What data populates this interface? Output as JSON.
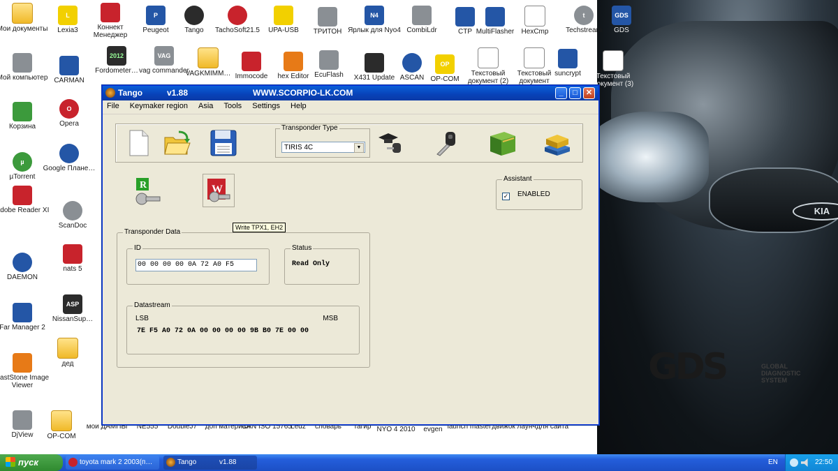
{
  "desktop": {
    "icons": [
      {
        "label": "Мои документы",
        "icon": "my-documents-icon"
      },
      {
        "label": "Lexia3",
        "icon": "lexia3-icon"
      },
      {
        "label": "Коннект Менеджер",
        "icon": "connect-manager-icon"
      },
      {
        "label": "Peugeot",
        "icon": "peugeot-icon"
      },
      {
        "label": "Tango",
        "icon": "tango-icon"
      },
      {
        "label": "TachoSoft21.5",
        "icon": "tachosoft-icon"
      },
      {
        "label": "UPA-USB",
        "icon": "upa-usb-icon"
      },
      {
        "label": "ТРИТОН",
        "icon": "triton-icon"
      },
      {
        "label": "Ярлык для Nyo4",
        "icon": "nyo4-icon"
      },
      {
        "label": "CombiLdr",
        "icon": "combildr-icon"
      },
      {
        "label": "CTP",
        "icon": "ctp-icon"
      },
      {
        "label": "MultiFlasher",
        "icon": "multiflasher-icon"
      },
      {
        "label": "HexCmp",
        "icon": "hexcmp-icon"
      },
      {
        "label": "Techstream",
        "icon": "techstream-icon"
      },
      {
        "label": "GDS",
        "icon": "gds-icon"
      },
      {
        "label": "Мой компьютер",
        "icon": "my-computer-icon"
      },
      {
        "label": "CARMAN",
        "icon": "carman-icon"
      },
      {
        "label": "Fordometer…",
        "icon": "fordometer-icon"
      },
      {
        "label": "vag commander",
        "icon": "vag-commander-icon"
      },
      {
        "label": "VAGKMIMM…",
        "icon": "folder-icon"
      },
      {
        "label": "Immocode",
        "icon": "immocode-icon"
      },
      {
        "label": "hex Editor",
        "icon": "hex-editor-icon"
      },
      {
        "label": "EcuFlash",
        "icon": "ecuflash-icon"
      },
      {
        "label": "X431 Update",
        "icon": "x431-icon"
      },
      {
        "label": "ASCAN",
        "icon": "ascan-icon"
      },
      {
        "label": "OP-COM",
        "icon": "opcom-icon"
      },
      {
        "label": "Текстовый документ (2)",
        "icon": "text-document-icon"
      },
      {
        "label": "Текстовый документ",
        "icon": "text-document-icon"
      },
      {
        "label": "suncrypt",
        "icon": "suncrypt-icon"
      },
      {
        "label": "Текстовый документ (3)",
        "icon": "text-document-icon"
      },
      {
        "label": "Корзина",
        "icon": "recycle-bin-icon"
      },
      {
        "label": "Opera",
        "icon": "opera-icon"
      },
      {
        "label": "µTorrent",
        "icon": "utorrent-icon"
      },
      {
        "label": "Google Плане…",
        "icon": "google-earth-icon"
      },
      {
        "label": "Adobe Reader XI",
        "icon": "adobe-reader-icon"
      },
      {
        "label": "ScanDoc",
        "icon": "scandoc-icon"
      },
      {
        "label": "nats 5",
        "icon": "nats-icon"
      },
      {
        "label": "DAEMON",
        "icon": "daemon-icon"
      },
      {
        "label": "Far Manager 2",
        "icon": "far-manager-icon"
      },
      {
        "label": "NissanSup…",
        "icon": "nissan-icon"
      },
      {
        "label": "дед",
        "icon": "folder-icon"
      },
      {
        "label": "FastStone Image Viewer",
        "icon": "faststone-icon"
      },
      {
        "label": "DjView",
        "icon": "djview-icon"
      },
      {
        "label": "OP-COM",
        "icon": "folder-icon"
      },
      {
        "label": "мои ДАМПЫ",
        "icon": "folder-icon"
      },
      {
        "label": "NE555",
        "icon": "folder-icon"
      },
      {
        "label": "DoubleJ7",
        "icon": "folder-icon"
      },
      {
        "label": "доп материал",
        "icon": "folder-icon"
      },
      {
        "label": "CAN ISO 15765",
        "icon": "folder-icon"
      },
      {
        "label": "Ledz",
        "icon": "folder-icon"
      },
      {
        "label": "словарь",
        "icon": "folder-icon"
      },
      {
        "label": "тагир",
        "icon": "folder-icon"
      },
      {
        "label": "NYO 4 2010",
        "icon": "folder-icon"
      },
      {
        "label": "evgen",
        "icon": "folder-icon"
      },
      {
        "label": "launch master",
        "icon": "folder-icon"
      },
      {
        "label": "движок лаунч",
        "icon": "folder-icon"
      },
      {
        "label": "для сайта",
        "icon": "folder-icon"
      }
    ],
    "gds_logo": {
      "letters": "GDS",
      "caption": [
        "GLOBAL",
        "DIAGNOSTIC",
        "SYSTEM"
      ]
    }
  },
  "window": {
    "title": "Tango",
    "version": "v1.88",
    "url": "WWW.SCORPIO-LK.COM",
    "menu": [
      "File",
      "Keymaker region",
      "Asia",
      "Tools",
      "Settings",
      "Help"
    ],
    "toolbar": {
      "buttons": [
        {
          "name": "new-file",
          "icon": "new-document-icon"
        },
        {
          "name": "open-file",
          "icon": "open-folder-icon"
        },
        {
          "name": "save-file",
          "icon": "floppy-disk-icon"
        },
        {
          "name": "key-learn",
          "icon": "graduate-key-icon"
        },
        {
          "name": "key-tool",
          "icon": "key-icon"
        },
        {
          "name": "book",
          "icon": "green-book-icon"
        },
        {
          "name": "books",
          "icon": "books-icon"
        }
      ],
      "transponder_type_label": "Transponder Type",
      "transponder_type_value": "TIRIS 4C"
    },
    "read_button": {
      "icon": "read-key-icon",
      "letter": "R"
    },
    "write_button": {
      "icon": "write-key-icon",
      "letter": "W"
    },
    "tooltip": "Write TPX1, EH2",
    "assistant": {
      "label": "Assistant",
      "checkbox_label": "ENABLED",
      "checked": true
    },
    "transponder_data": {
      "label": "Transponder Data",
      "id_label": "ID",
      "id_value": "00 00 00 00 0A 72 A0 F5",
      "status_label": "Status",
      "status_value": "Read Only",
      "datastream_label": "Datastream",
      "lsb": "LSB",
      "msb": "MSB",
      "datastream_value": "7E F5 A0 72 0A 00 00 00 00 9B B0 7E 00 00"
    }
  },
  "taskbar": {
    "start_label": "пуск",
    "tasks": [
      {
        "label": "toyota mark 2 2003(п…",
        "icon": "opera-icon"
      },
      {
        "label": "Tango",
        "extra": "v1.88",
        "icon": "tango-icon"
      }
    ],
    "language": "EN",
    "clock": "22:50"
  },
  "colors": {
    "titlebar": "#0a5fd8",
    "window_bg": "#ece9d8",
    "taskbar": "#245edb",
    "start": "#3c9a3c",
    "gds_red": "#d32027"
  }
}
